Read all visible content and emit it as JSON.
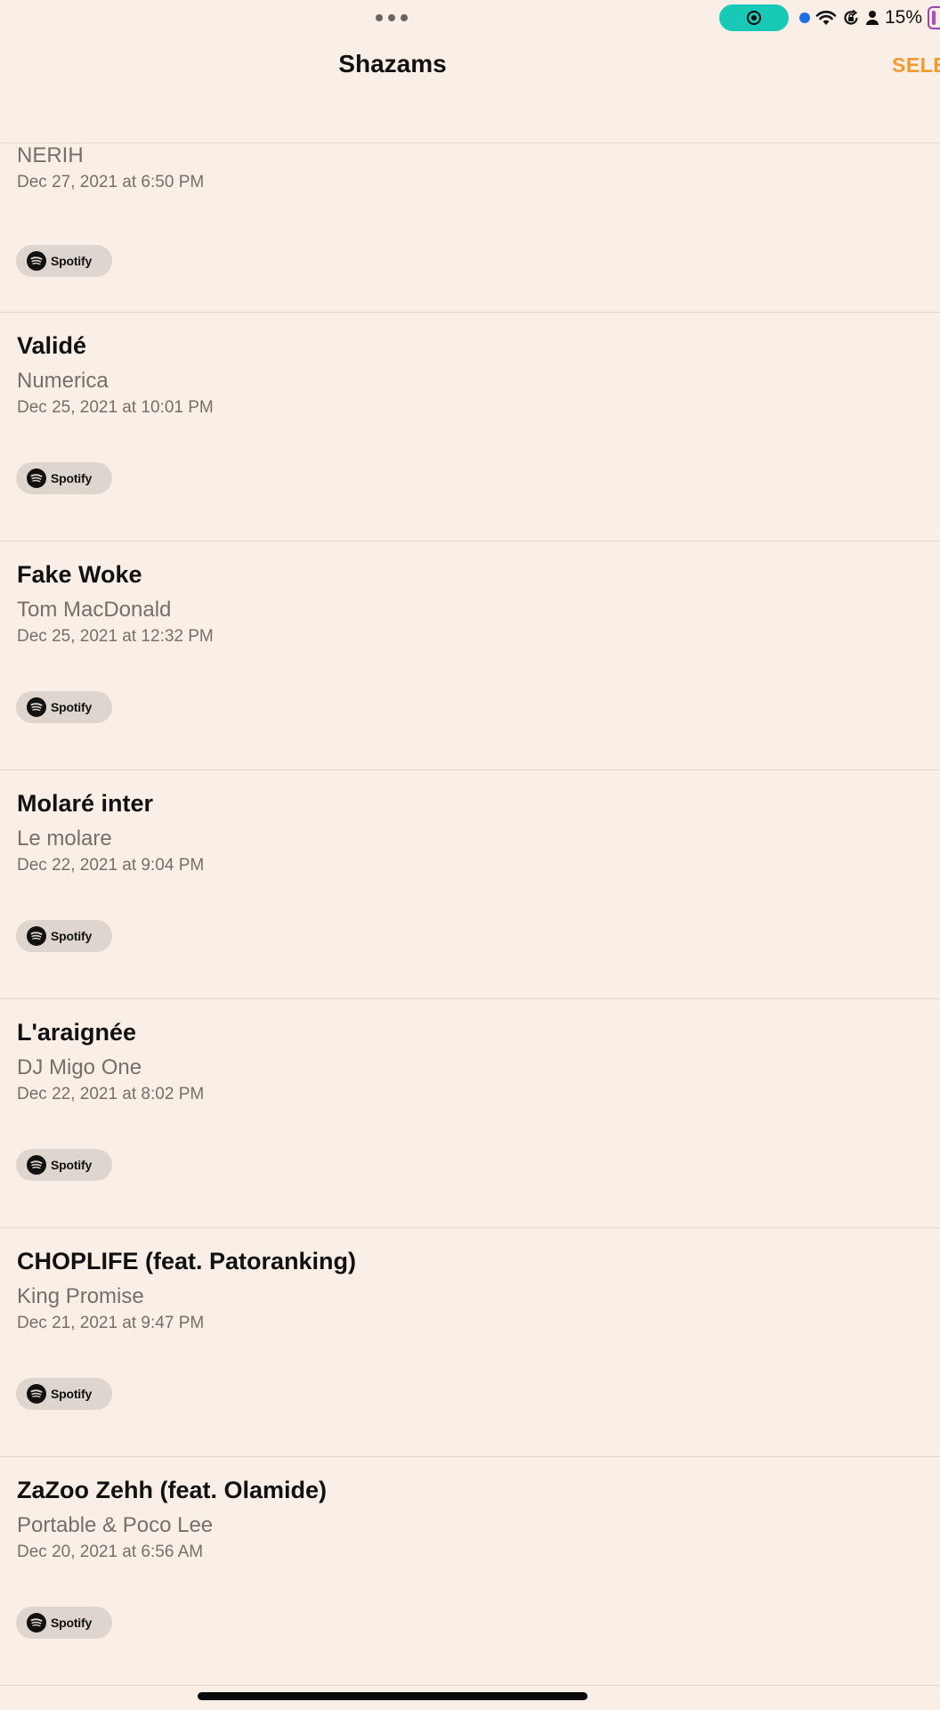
{
  "status_bar": {
    "battery_percent": "15%",
    "icons": [
      "more-dots-icon",
      "screen-record-icon",
      "location-dot-icon",
      "wifi-icon",
      "orientation-lock-icon",
      "person-icon",
      "battery-icon"
    ],
    "colors": {
      "record_pill": "#19c9b8",
      "location_dot": "#1f6fe0",
      "battery": "#b04cc0"
    }
  },
  "nav": {
    "title": "Shazams",
    "select_label": "SELE",
    "accent_color": "#f29a2e"
  },
  "shazams": [
    {
      "title": "",
      "artist": "NERIH",
      "date": "Dec 27, 2021 at 6:50 PM",
      "service": "Spotify"
    },
    {
      "title": "Validé",
      "artist": "Numerica",
      "date": "Dec 25, 2021 at 10:01 PM",
      "service": "Spotify"
    },
    {
      "title": "Fake Woke",
      "artist": "Tom MacDonald",
      "date": "Dec 25, 2021 at 12:32 PM",
      "service": "Spotify"
    },
    {
      "title": "Molaré inter",
      "artist": "Le molare",
      "date": "Dec 22, 2021 at 9:04 PM",
      "service": "Spotify"
    },
    {
      "title": "L'araignée",
      "artist": "DJ Migo One",
      "date": "Dec 22, 2021 at 8:02 PM",
      "service": "Spotify"
    },
    {
      "title": "CHOPLIFE (feat. Patoranking)",
      "artist": "King Promise",
      "date": "Dec 21, 2021 at 9:47 PM",
      "service": "Spotify"
    },
    {
      "title": "ZaZoo Zehh (feat. Olamide)",
      "artist": "Portable & Poco Lee",
      "date": "Dec 20, 2021 at 6:56 AM",
      "service": "Spotify"
    }
  ]
}
